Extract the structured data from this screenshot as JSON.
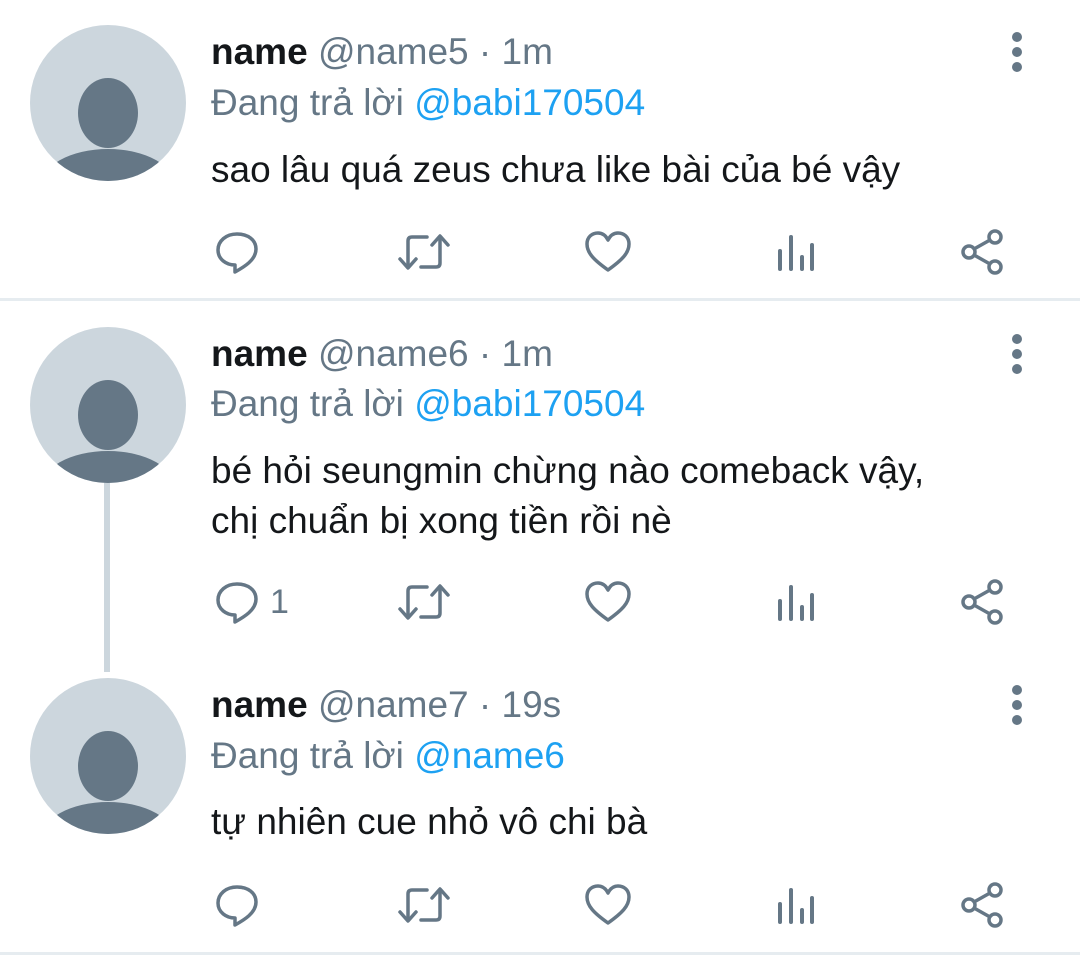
{
  "tweets": [
    {
      "name": "name",
      "handle": "@name5",
      "separator": "·",
      "time": "1m",
      "replying_prefix": "Đang trả lời",
      "replying_to": "@babi170504",
      "text": "sao lâu quá zeus chưa like bài của bé vậy",
      "reply_count": ""
    },
    {
      "name": "name",
      "handle": "@name6",
      "separator": "·",
      "time": "1m",
      "replying_prefix": "Đang trả lời",
      "replying_to": "@babi170504",
      "text": "bé hỏi seungmin chừng nào comeback vậy,\nchị chuẩn bị xong tiền rồi nè",
      "reply_count": "1"
    },
    {
      "name": "name",
      "handle": "@name7",
      "separator": "·",
      "time": "19s",
      "replying_prefix": "Đang trả lời",
      "replying_to": "@name6",
      "text": "tự nhiên cue nhỏ vô chi bà",
      "reply_count": ""
    }
  ],
  "icons": {
    "reply": "reply-icon",
    "retweet": "retweet-icon",
    "like": "like-icon",
    "analytics": "analytics-icon",
    "share": "share-icon",
    "more": "more-vertical-icon",
    "avatar": "default-avatar-icon"
  },
  "colors": {
    "text": "#14171a",
    "secondary": "#657786",
    "mention": "#1da1f2",
    "avatar_bg": "#ccd6dd",
    "avatar_fg": "#657786",
    "divider": "#e6ecf0"
  }
}
